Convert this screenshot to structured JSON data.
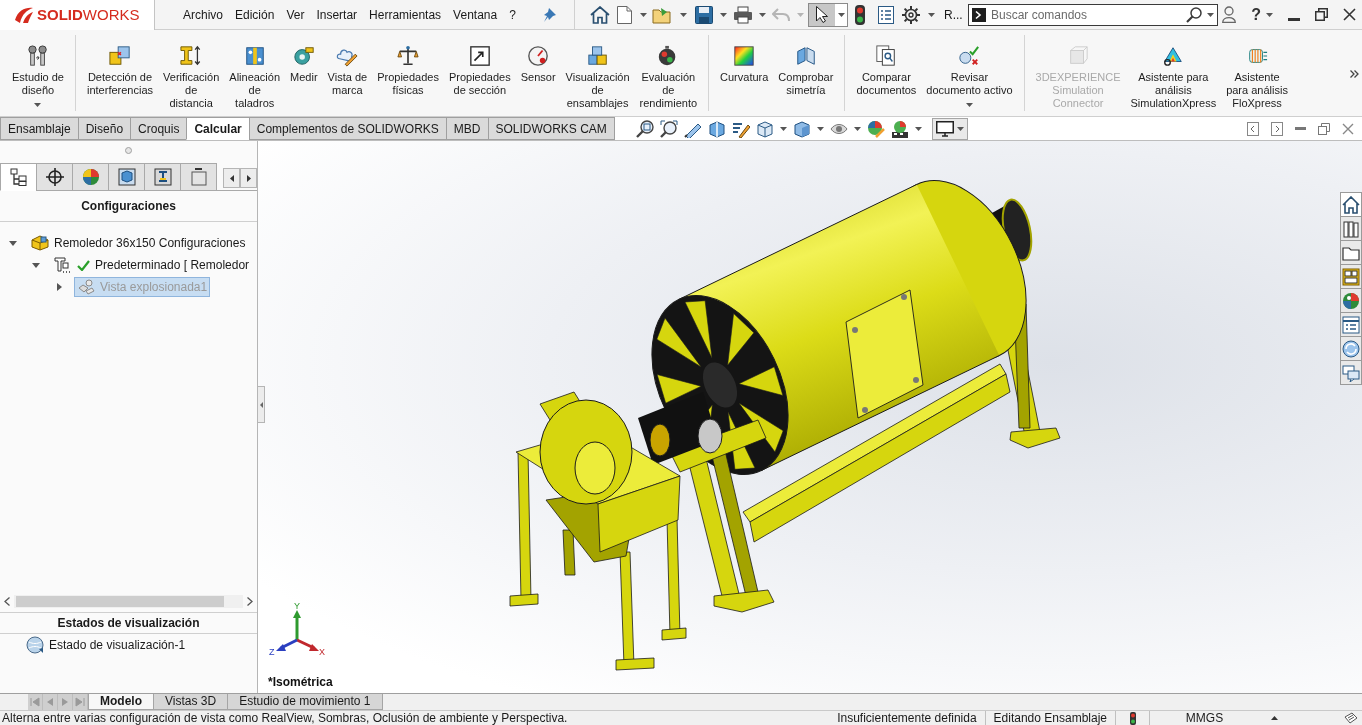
{
  "title_bar": {
    "logo": "**SOLID**WORKS",
    "menu": [
      "Archivo",
      "Edición",
      "Ver",
      "Insertar",
      "Herramientas",
      "Ventana",
      "?"
    ],
    "select_tool": {
      "pressed": true
    },
    "overflow_label": "R...",
    "search": {
      "placeholder": "Buscar comandos"
    },
    "help": "?"
  },
  "ribbon": {
    "groups": [
      {
        "items": [
          {
            "label": "Estudio de\ndiseño",
            "dropdown": true,
            "disabled": false
          }
        ]
      },
      {
        "items": [
          {
            "label": "Detección de\ninterferencias",
            "dropdown": false,
            "disabled": false
          },
          {
            "label": "Verificación\nde\ndistancia",
            "dropdown": false,
            "disabled": false
          },
          {
            "label": "Alineación\nde\ntaladros",
            "dropdown": false,
            "disabled": false
          },
          {
            "label": "Medir",
            "dropdown": false,
            "disabled": false
          },
          {
            "label": "Vista de\nmarca",
            "dropdown": false,
            "disabled": false
          },
          {
            "label": "Propiedades\nfísicas",
            "dropdown": false,
            "disabled": false
          },
          {
            "label": "Propiedades\nde sección",
            "dropdown": false,
            "disabled": false
          },
          {
            "label": "Sensor",
            "dropdown": false,
            "disabled": false
          },
          {
            "label": "Visualización\nde\nensamblajes",
            "dropdown": false,
            "disabled": false
          },
          {
            "label": "Evaluación\nde\nrendimiento",
            "dropdown": false,
            "disabled": false
          }
        ]
      },
      {
        "items": [
          {
            "label": "Curvatura",
            "dropdown": false,
            "disabled": false
          },
          {
            "label": "Comprobar\nsimetría",
            "dropdown": false,
            "disabled": false
          }
        ]
      },
      {
        "items": [
          {
            "label": "Comparar\ndocumentos",
            "dropdown": false,
            "disabled": false
          },
          {
            "label": "Revisar\ndocumento activo",
            "dropdown": true,
            "disabled": false
          }
        ]
      },
      {
        "items": [
          {
            "label": "3DEXPERIENCE\nSimulation\nConnector",
            "dropdown": false,
            "disabled": true
          },
          {
            "label": "Asistente para\nanálisis\nSimulationXpress",
            "dropdown": false,
            "disabled": false
          },
          {
            "label": "Asistente\npara análisis\nFloXpress",
            "dropdown": false,
            "disabled": false
          }
        ]
      }
    ]
  },
  "command_tabs": [
    {
      "label": "Ensamblaje",
      "selected": false
    },
    {
      "label": "Diseño",
      "selected": false
    },
    {
      "label": "Croquis",
      "selected": false
    },
    {
      "label": "Calcular",
      "selected": true
    },
    {
      "label": "Complementos de SOLIDWORKS",
      "selected": false
    },
    {
      "label": "MBD",
      "selected": false
    },
    {
      "label": "SOLIDWORKS CAM",
      "selected": false
    }
  ],
  "feature_panel": {
    "tabs": [
      {
        "selected": true
      },
      {
        "selected": false
      },
      {
        "selected": false
      },
      {
        "selected": false
      },
      {
        "selected": false
      },
      {
        "selected": false
      }
    ],
    "title": "Configuraciones",
    "tree": [
      {
        "kind": "assembly",
        "label": "Remoledor 36x150 Configuraciones",
        "expanded": true,
        "selected": false,
        "active": false,
        "suppressed": false,
        "children": [
          {
            "kind": "configuration",
            "label": "Predeterminado [ Remoledor",
            "expanded": true,
            "selected": false,
            "active": true,
            "suppressed": false,
            "children": [
              {
                "kind": "exploded_view",
                "label": "Vista explosionada1",
                "expanded": false,
                "selected": true,
                "active": false,
                "suppressed": true
              }
            ]
          }
        ]
      }
    ],
    "display_states": {
      "title": "Estados de visualización",
      "items": [
        "Estado de visualización-1"
      ]
    }
  },
  "viewport": {
    "view_name": "*Isométrica",
    "triad": {
      "x": "X",
      "y": "Y",
      "z": "Z"
    },
    "task_pane": [
      {
        "selected": true
      },
      {
        "selected": false
      },
      {
        "selected": false
      },
      {
        "selected": false
      },
      {
        "selected": false
      },
      {
        "selected": false
      },
      {
        "selected": false
      },
      {
        "selected": false
      }
    ]
  },
  "bottom_tabs": [
    {
      "label": "Modelo",
      "selected": true
    },
    {
      "label": "Vistas 3D",
      "selected": false
    },
    {
      "label": "Estudio de movimiento 1",
      "selected": false
    }
  ],
  "status_bar": {
    "message": "Alterna entre varias configuración de vista como RealView, Sombras, Oclusión de ambiente y Perspectiva.",
    "definition": "Insuficientemente definida",
    "mode": "Editando Ensamblaje",
    "units": "MMGS"
  }
}
